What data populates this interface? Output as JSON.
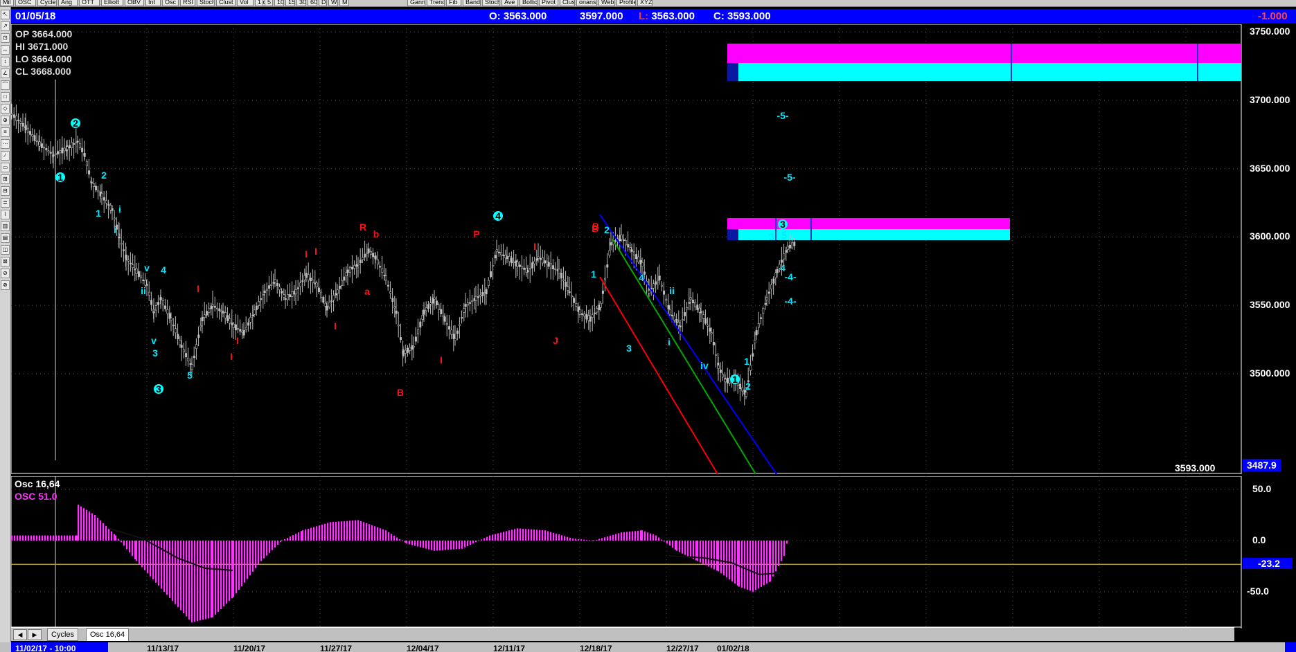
{
  "toolbar": {
    "buttons": [
      "Mil",
      "OSC",
      "Cycles",
      "Ang",
      "OTT",
      "Elliott",
      "OBV",
      "Int",
      "Osc",
      "RSI",
      "Stoch",
      "Clust",
      "Vol",
      "Flow",
      "1",
      "5",
      "10",
      "15",
      "30",
      "60",
      "D",
      "W",
      "M",
      "Gann",
      "Trend",
      "Fib",
      "Band",
      "Stoch",
      "Ave",
      "Bollic",
      "Pivot",
      "Clust",
      "onans",
      "Web",
      "Profile",
      "XYZ"
    ]
  },
  "header": {
    "date": "01/05/18",
    "open": "O: 3563.000",
    "high": "3597.000",
    "low": "L: 3563.000",
    "close": "C: 3593.000",
    "change": "-1.000"
  },
  "ohlc_box": {
    "op": "OP  3664.000",
    "hi": "HI   3671.000",
    "lo": "LO  3664.000",
    "cl": "CL  3668.000"
  },
  "price_axis": {
    "ticks": [
      "3750.000",
      "3700.000",
      "3650.000",
      "3600.000",
      "3550.000",
      "3500.000"
    ],
    "last_price": "3593.000",
    "cursor_price": "3487.9"
  },
  "oscillator": {
    "title": "Osc 16,64",
    "subtitle": "OSC 51.0",
    "ticks": [
      "50.0",
      "0.0",
      "-50.0"
    ],
    "current": "-23.2"
  },
  "tabs": {
    "items": [
      "Cycles",
      "Osc 16,64"
    ],
    "active": 1
  },
  "date_axis": {
    "cursor_date": "11/02/17 - 10:00",
    "labels": [
      "11/13/17",
      "11/20/17",
      "11/27/17",
      "12/04/17",
      "12/11/17",
      "12/18/17",
      "12/27/17",
      "01/02/18"
    ]
  },
  "wave_labels": {
    "cyan_circles": [
      "1",
      "2",
      "3",
      "4",
      "3",
      "1"
    ],
    "cyan": [
      "2",
      "1",
      "i",
      "i",
      "v",
      "4",
      "ii",
      "v",
      "3",
      "5",
      "2",
      "1",
      "4",
      "ii",
      "3",
      "i",
      "iv",
      "1",
      "2",
      "3",
      "5",
      "4",
      "-5-",
      "-5-",
      "-4-",
      "-4-"
    ],
    "red": [
      "R",
      "b",
      "a",
      "P",
      "I",
      "B",
      "I",
      "I",
      "I",
      "I",
      "I",
      "I",
      "I",
      "J",
      "B",
      "B"
    ]
  },
  "colors": {
    "header_bg": "#0000ff",
    "magenta": "#ff00ff",
    "cyan": "#00ffff",
    "red": "#ff0000",
    "blue_line": "#0000ff",
    "green_line": "#00aa00",
    "candles": "#bfbfbf"
  }
}
